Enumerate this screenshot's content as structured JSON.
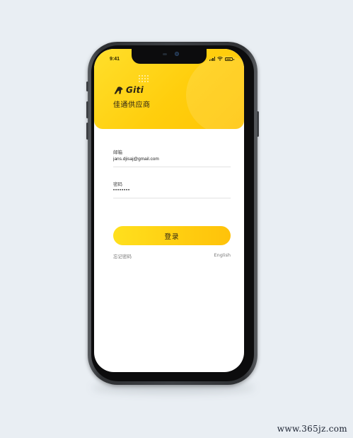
{
  "status_bar": {
    "time": "9:41"
  },
  "header": {
    "brand": "Giti",
    "subtitle": "佳通供应商",
    "accent_color": "#ffd11a"
  },
  "form": {
    "email": {
      "label": "邮箱",
      "value": "jans.djisaj@gmail.com"
    },
    "password": {
      "label": "密码",
      "value": "••••••••"
    },
    "login_label": "登录"
  },
  "links": {
    "forgot_password": "忘记密码",
    "language": "English"
  },
  "watermark": "www.365jz.com",
  "icons": {
    "brand_logo": "giti-logo-icon",
    "signal": "signal-icon",
    "wifi": "wifi-icon",
    "battery": "battery-icon"
  }
}
